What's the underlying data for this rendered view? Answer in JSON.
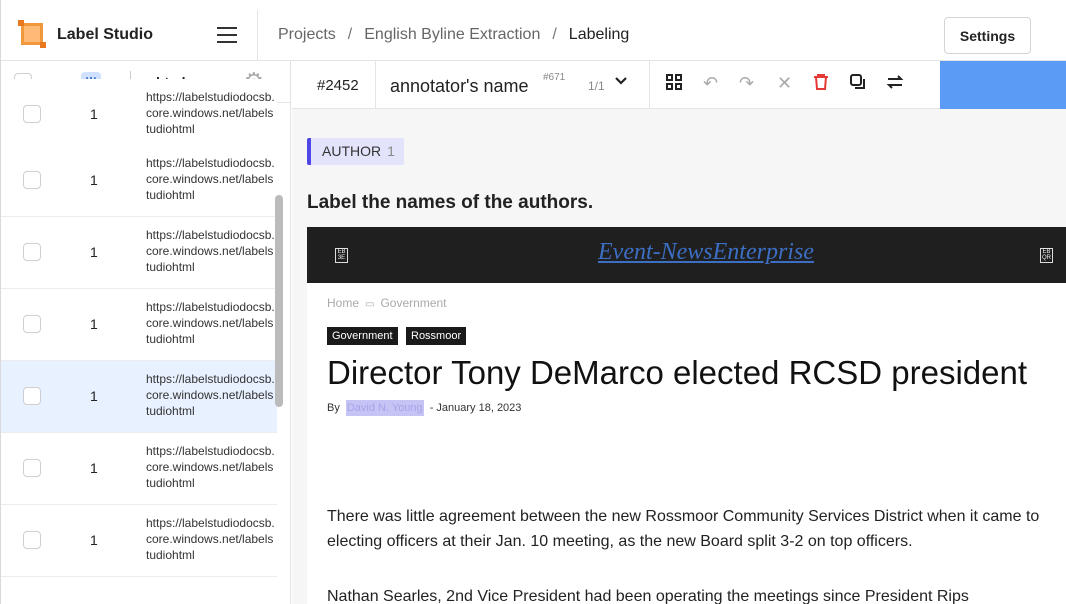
{
  "app": {
    "name": "Label Studio"
  },
  "breadcrumb": {
    "projects": "Projects",
    "project": "English Byline Extraction",
    "current": "Labeling",
    "sep": "/"
  },
  "settings_label": "Settings",
  "table": {
    "column_label": "html",
    "rows": [
      {
        "count": "1",
        "url": "https://labelstudiodocsb.core.windows.net/labelstudiohtml"
      },
      {
        "count": "1",
        "url": "https://labelstudiodocsb.core.windows.net/labelstudiohtml"
      },
      {
        "count": "1",
        "url": "https://labelstudiodocsb.core.windows.net/labelstudiohtml"
      },
      {
        "count": "1",
        "url": "https://labelstudiodocsb.core.windows.net/labelstudiohtml"
      },
      {
        "count": "1",
        "url": "https://labelstudiodocsb.core.windows.net/labelstudiohtml",
        "selected": true
      },
      {
        "count": "1",
        "url": "https://labelstudiodocsb.core.windows.net/labelstudiohtml"
      },
      {
        "count": "1",
        "url": "https://labelstudiodocsb.core.windows.net/labelstudiohtml"
      }
    ]
  },
  "task": {
    "id": "#2452",
    "annotator": "annotator's name",
    "annotation_id": "#671",
    "count": "1/1"
  },
  "icons": {
    "grid": "grid-icon",
    "undo": "undo-icon",
    "redo": "redo-icon",
    "close": "close-icon",
    "delete": "trash-icon",
    "copy": "copy-icon",
    "swap": "swap-icon",
    "gear": "gear-icon",
    "chevron": "chevron-down-icon"
  },
  "colors": {
    "accent": "#5b9bf5",
    "label": "#4f46e5",
    "delete": "#e53935"
  },
  "label": {
    "name": "AUTHOR",
    "count": "1"
  },
  "instruction": "Label the names of the authors.",
  "article": {
    "site": "Event-NewsEnterprise",
    "breadcrumb": {
      "home": "Home",
      "section": "Government"
    },
    "tags": [
      "Government",
      "Rossmoor"
    ],
    "headline": "Director Tony DeMarco elected RCSD president",
    "by": "By",
    "author": "David N. Young",
    "date": "- January 18, 2023",
    "paragraphs": [
      "There was little agreement between the new Rossmoor Community Services District when it came to electing officers at their Jan. 10 meeting, as the new Board split 3-2 on top officers.",
      "Nathan Searles, 2nd Vice President had been operating the meetings since President Rips"
    ]
  }
}
